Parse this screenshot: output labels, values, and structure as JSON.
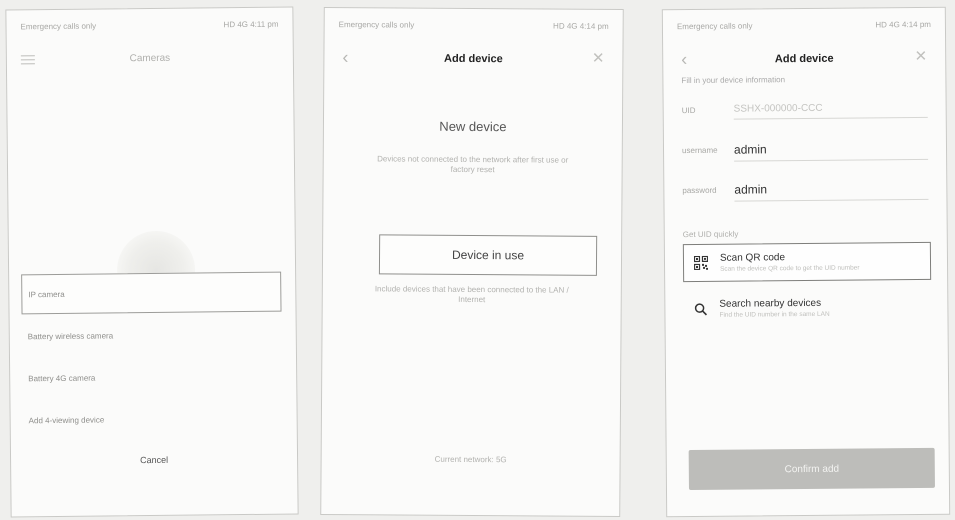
{
  "screen1": {
    "status_left": "Emergency calls only",
    "status_right": "HD 4G 4:11 pm",
    "title": "Cameras",
    "options": [
      "IP camera",
      "Battery wireless camera",
      "Battery 4G camera",
      "Add 4-viewing device"
    ],
    "selected_index": 0,
    "cancel": "Cancel"
  },
  "screen2": {
    "status_left": "Emergency calls only",
    "status_right": "HD 4G 4:14 pm",
    "title": "Add device",
    "heading": "New device",
    "hint_new": "Devices not connected to the network after first use or factory reset",
    "device_in_use": "Device in use",
    "hint_in_use": "Include devices that have been connected to the LAN / Internet",
    "footer": "Current network: 5G"
  },
  "screen3": {
    "status_left": "Emergency calls only",
    "status_right": "HD 4G 4:14 pm",
    "title": "Add device",
    "fill_hint": "Fill in your device information",
    "fields": [
      {
        "label": "UID",
        "value": "SSHX-000000-CCC"
      },
      {
        "label": "username",
        "value": "admin"
      },
      {
        "label": "password",
        "value": "admin"
      }
    ],
    "get_uid": "Get UID quickly",
    "scan": {
      "title": "Scan QR code",
      "sub": "Scan the device QR code to get the UID number"
    },
    "search": {
      "title": "Search nearby devices",
      "sub": "Find the UID number in the same LAN"
    },
    "confirm": "Confirm add"
  }
}
